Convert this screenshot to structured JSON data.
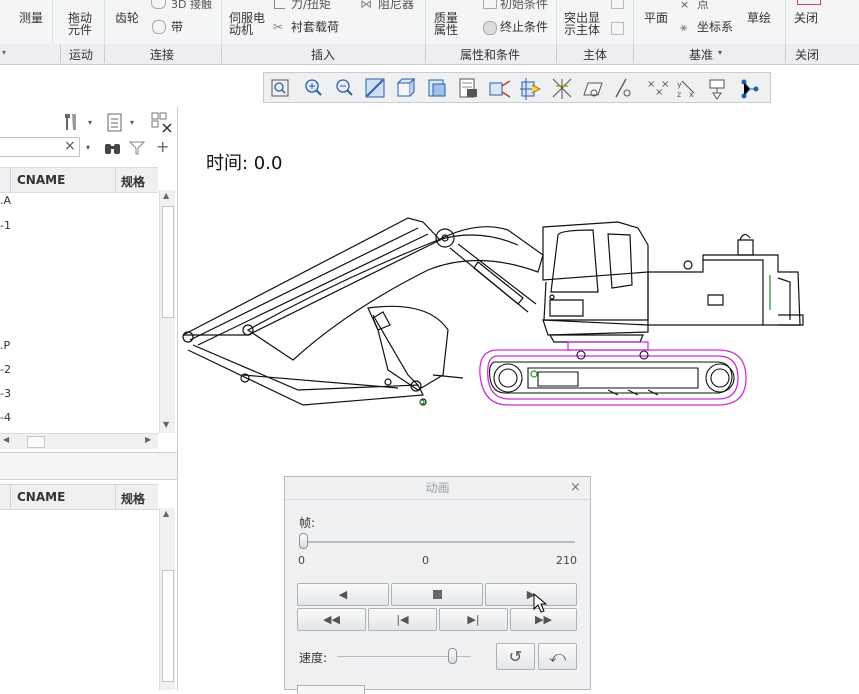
{
  "ribbon": {
    "measure": "测量",
    "drag_components": [
      "拖动",
      "元件"
    ],
    "gear": "齿轮",
    "contact_3d": "3D 接触",
    "belt": "带",
    "servo_motor": [
      "伺服电",
      "动机"
    ],
    "force_torque": "力/扭矩",
    "bushing_load": "衬套载荷",
    "damper": "阻尼器",
    "mass_properties": [
      "质量",
      "属性"
    ],
    "initial_condition": "初始条件",
    "termination_condition": "终止条件",
    "highlight_body": [
      "突出显",
      "示主体"
    ],
    "plane": "平面",
    "point": "点",
    "coordinate_system": "坐标系",
    "sketch": "草绘",
    "close": "关闭"
  },
  "groups": {
    "motion": "运动",
    "connect": "连接",
    "insert": "插入",
    "properties_conditions": "属性和条件",
    "body": "主体",
    "datum": "基准",
    "close": "关闭"
  },
  "view_toolbar": {
    "icons": [
      "refit-icon",
      "zoom-in-icon",
      "zoom-out-icon",
      "repaint-icon",
      "display-style-icon",
      "view-manager-icon",
      "saved-views-icon",
      "perspective-icon",
      "section-icon",
      "datum-display-icon",
      "plane-display-icon",
      "axis-display-icon",
      "point-display-icon",
      "csys-display-icon",
      "annotation-display-icon",
      "spin-center-icon"
    ]
  },
  "model_tree_top": {
    "header": {
      "col2": "CNAME",
      "col3": "规格"
    },
    "rows": [
      ".A",
      "-1",
      ".P",
      "-2",
      "-3",
      "-4"
    ]
  },
  "model_tree_bottom": {
    "header": {
      "col2": "CNAME",
      "col3": "规格"
    }
  },
  "canvas": {
    "time_label": "时间: 0.0"
  },
  "animation_dialog": {
    "title": "动画",
    "frame_label": "帧:",
    "frame_min": "0",
    "frame_current": "0",
    "frame_max": "210",
    "frame_position": 0,
    "speed_label": "速度:",
    "speed_position": 0.86
  },
  "colors": {
    "highlight_magenta": "#d22fd2",
    "edge_black": "#111111",
    "accent_green": "#2a8a2a"
  }
}
